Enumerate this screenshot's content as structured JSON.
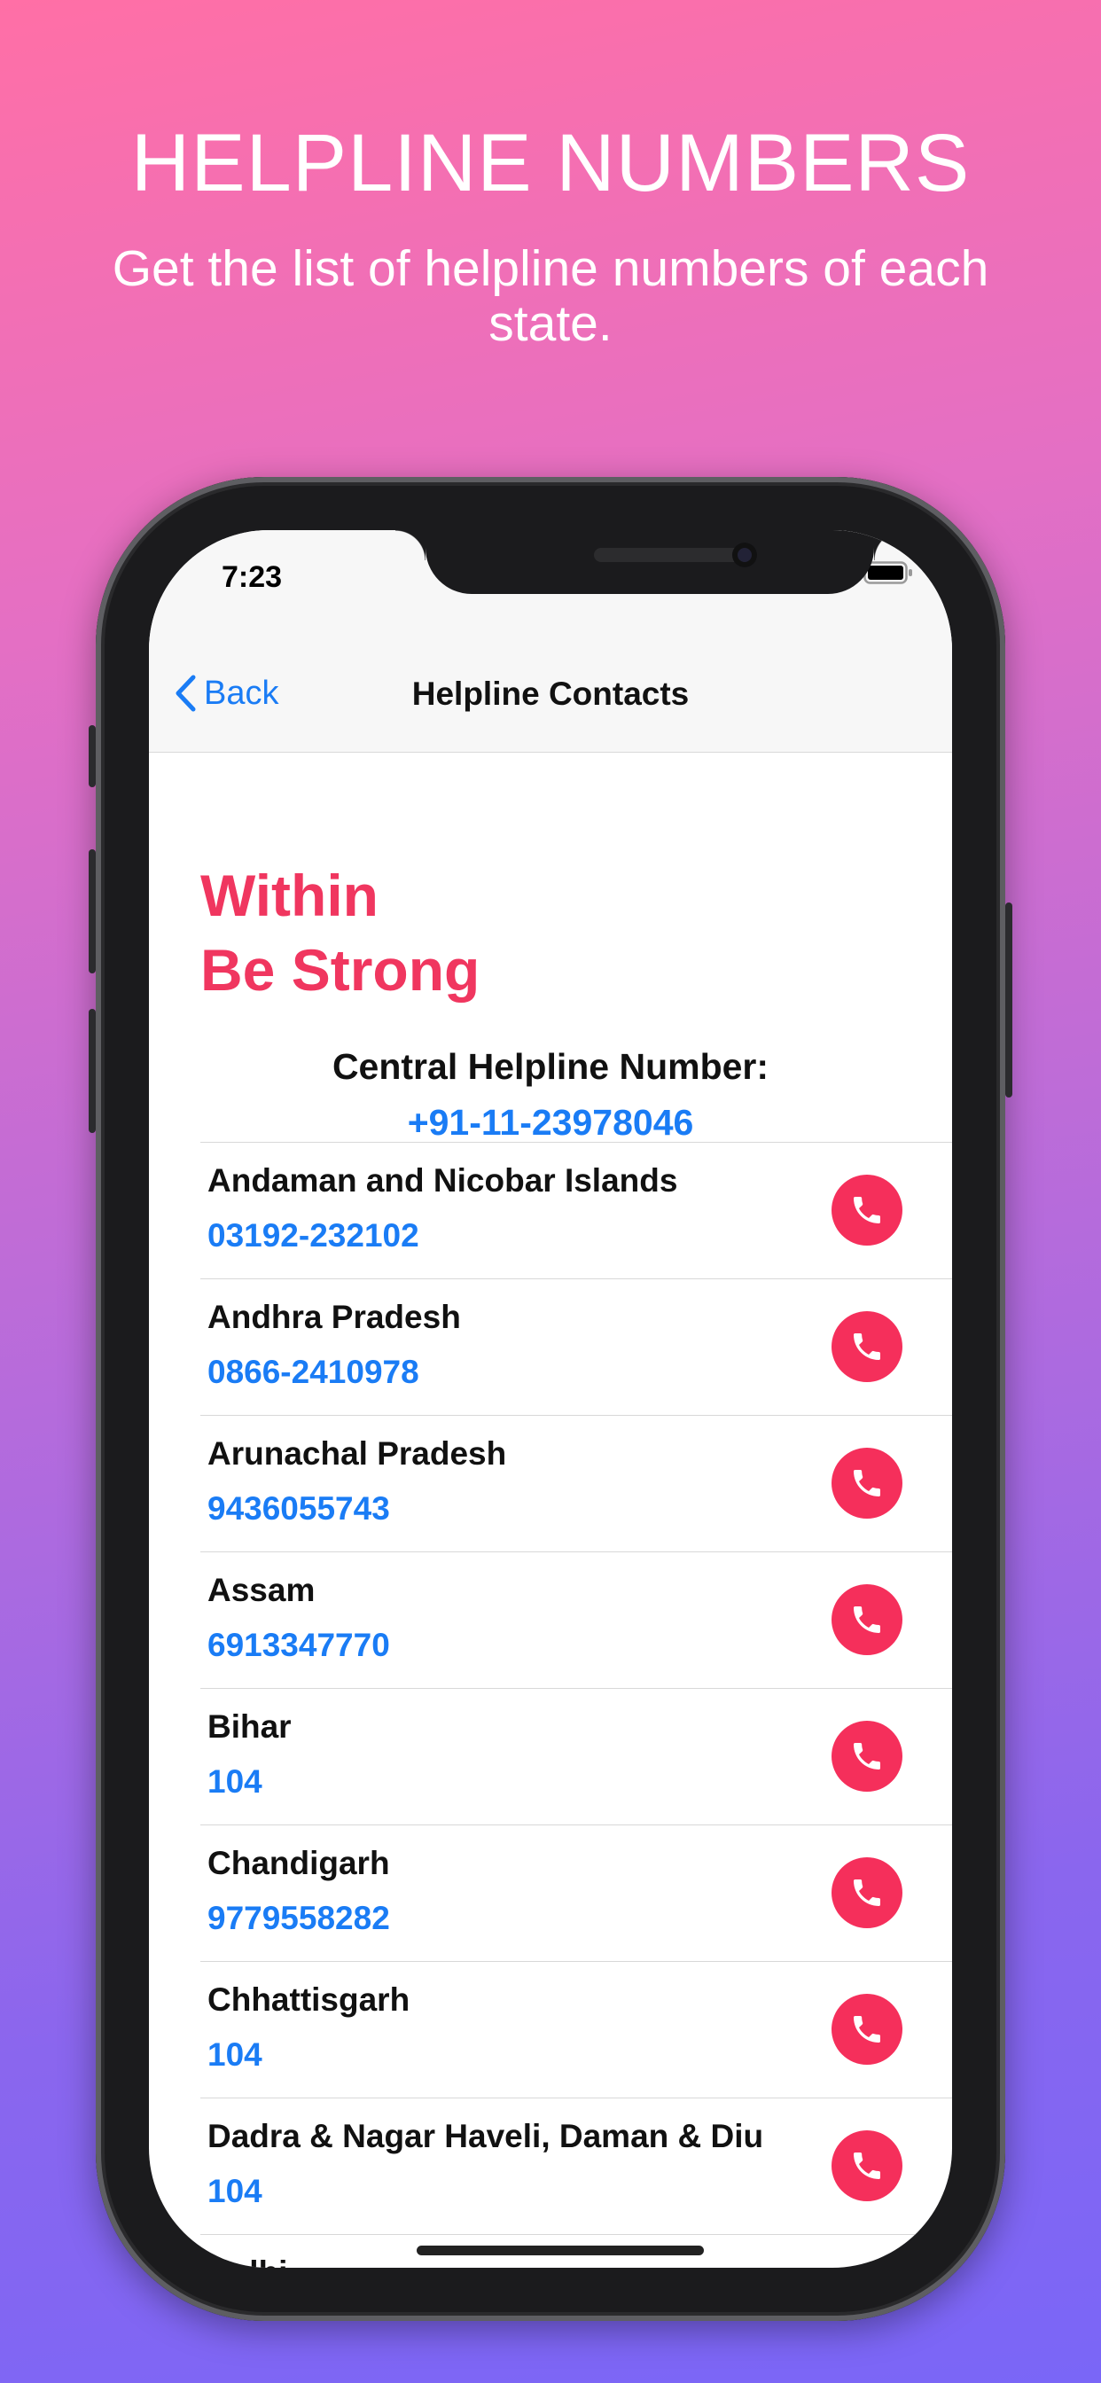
{
  "promo": {
    "title": "HELPLINE NUMBERS",
    "subtitle": "Get the list of helpline numbers of each state."
  },
  "status_bar": {
    "time": "7:23"
  },
  "nav": {
    "back_label": "Back",
    "title": "Helpline Contacts"
  },
  "app": {
    "title_line1": "Within",
    "title_line2": "Be Strong"
  },
  "central": {
    "label": "Central Helpline Number:",
    "number": "+91-11-23978046"
  },
  "contacts": [
    {
      "name": "Andaman and Nicobar Islands",
      "number": "03192-232102"
    },
    {
      "name": "Andhra Pradesh",
      "number": "0866-2410978"
    },
    {
      "name": "Arunachal Pradesh",
      "number": "9436055743"
    },
    {
      "name": "Assam",
      "number": "6913347770"
    },
    {
      "name": "Bihar",
      "number": "104"
    },
    {
      "name": "Chandigarh",
      "number": "9779558282"
    },
    {
      "name": "Chhattisgarh",
      "number": "104"
    },
    {
      "name": "Dadra & Nagar Haveli, Daman & Diu",
      "number": "104"
    },
    {
      "name": "Delhi",
      "number": ""
    }
  ],
  "colors": {
    "accent_red": "#f52f5b",
    "title_red": "#f0365f",
    "link_blue": "#1a7cf5"
  },
  "icons": {
    "back": "chevron-left-icon",
    "call": "phone-icon",
    "wifi": "wifi-icon",
    "battery": "battery-icon",
    "signal": "signal-icon"
  }
}
